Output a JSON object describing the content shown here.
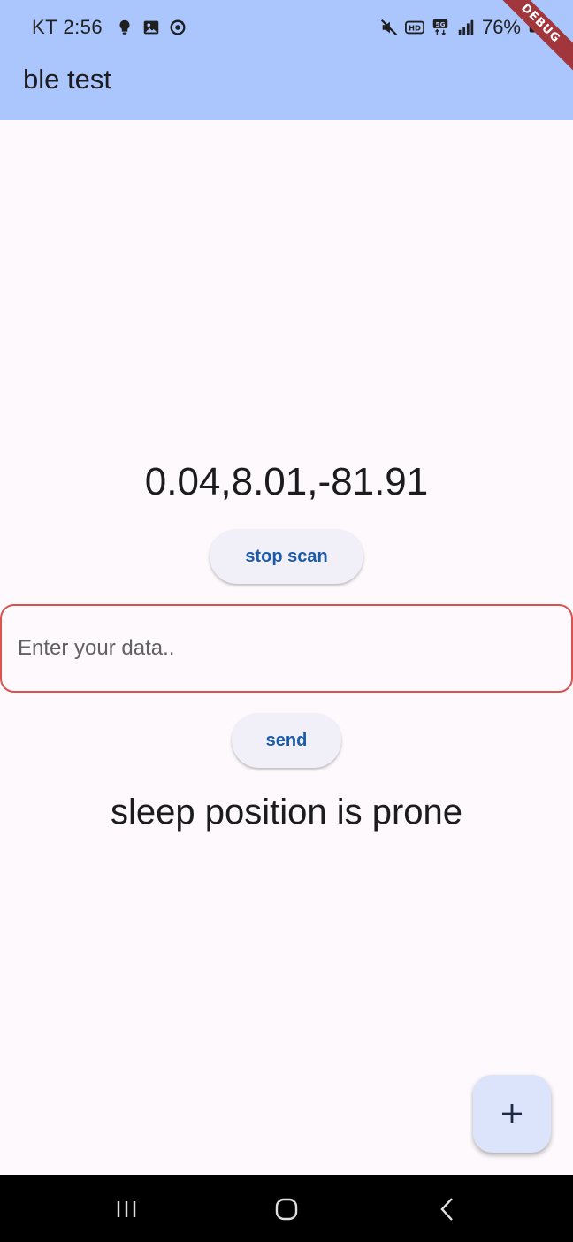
{
  "status_bar": {
    "time": "KT 2:56",
    "battery": "76%",
    "left_icons": [
      "lightbulb-icon",
      "image-icon",
      "sync-icon"
    ],
    "right_icons": [
      "mute-icon",
      "hd-icon",
      "5g-icon",
      "signal-icon",
      "battery-icon"
    ]
  },
  "app_bar": {
    "title": "ble test",
    "debug_banner": "DEBUG",
    "color": "#abc6fd"
  },
  "main": {
    "reading": "0.04,8.01,-81.91",
    "stop_scan_label": "stop scan",
    "input_placeholder": "Enter your data..",
    "send_label": "send",
    "sleep_status": "sleep position is prone"
  },
  "fab": {
    "icon": "plus-icon",
    "color": "#dce4fb"
  },
  "nav_bar": {
    "items": [
      "recents-icon",
      "home-icon",
      "back-icon"
    ]
  },
  "colors": {
    "accent": "#1a5bab",
    "error_border": "#d9534f",
    "background": "#fdf9fd"
  }
}
